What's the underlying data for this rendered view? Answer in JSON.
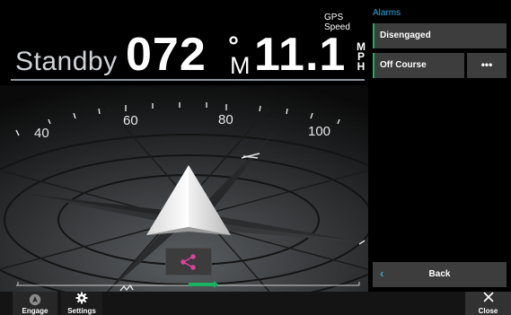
{
  "autopilot": {
    "mode": "Standby",
    "heading": "072",
    "heading_degree": "°",
    "heading_unit": "M",
    "speed_label": "GPS Speed",
    "speed": "11.1",
    "speed_unit": "MPH"
  },
  "compass": {
    "scale_labels": [
      "40",
      "60",
      "80",
      "100"
    ]
  },
  "sidebar": {
    "title": "Alarms",
    "buttons": {
      "disengaged": "Disengaged",
      "off_course": "Off Course",
      "more": "•••",
      "back": "Back"
    }
  },
  "bottom_bar": {
    "engage": "Engage",
    "settings": "Settings",
    "close": "Close"
  },
  "colors": {
    "accent": "#29a9e0",
    "status_green": "#17b35f",
    "button_bg": "#3d3d3d",
    "route_icon": "#e040a0"
  },
  "icons": {
    "heading_arrow": "arrow-up-icon",
    "route": "share-route-icon",
    "back": "chevron-left-icon",
    "engage": "autopilot-icon",
    "settings": "gear-icon",
    "close": "close-icon"
  }
}
